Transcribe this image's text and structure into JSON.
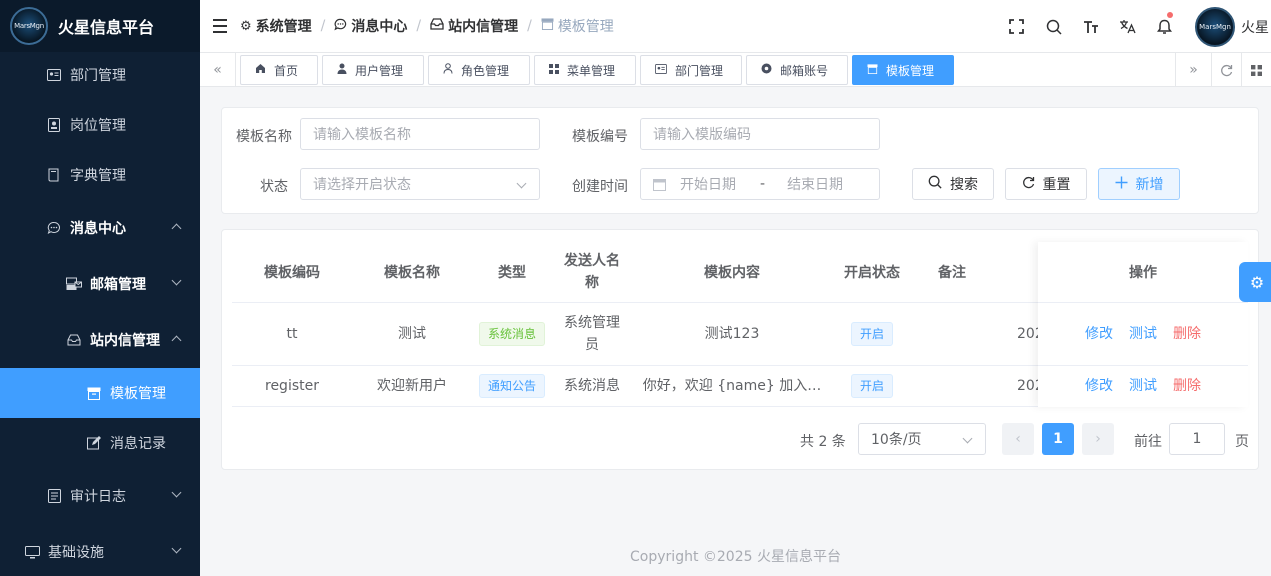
{
  "app": {
    "title": "火星信息平台",
    "logo_text": "MarsMgn"
  },
  "sidebar": {
    "items": [
      {
        "label": "部门管理",
        "icon": "id-card-icon"
      },
      {
        "label": "岗位管理",
        "icon": "badge-icon"
      },
      {
        "label": "字典管理",
        "icon": "book-icon"
      },
      {
        "label": "消息中心",
        "icon": "chat-icon"
      },
      {
        "label": "邮箱管理",
        "icon": "mail-server-icon"
      },
      {
        "label": "站内信管理",
        "icon": "inbox-icon"
      },
      {
        "label": "模板管理",
        "icon": "template-icon"
      },
      {
        "label": "消息记录",
        "icon": "edit-icon"
      },
      {
        "label": "审计日志",
        "icon": "log-icon"
      },
      {
        "label": "基础设施",
        "icon": "monitor-icon"
      }
    ]
  },
  "header": {
    "breadcrumb": [
      "系统管理",
      "消息中心",
      "站内信管理",
      "模板管理"
    ],
    "username": "火星"
  },
  "tags": [
    "首页",
    "用户管理",
    "角色管理",
    "菜单管理",
    "部门管理",
    "邮箱账号",
    "模板管理"
  ],
  "search": {
    "name_label": "模板名称",
    "name_placeholder": "请输入模板名称",
    "code_label": "模板编号",
    "code_placeholder": "请输入模版编码",
    "status_label": "状态",
    "status_placeholder": "请选择开启状态",
    "time_label": "创建时间",
    "start_placeholder": "开始日期",
    "range_sep": "-",
    "end_placeholder": "结束日期",
    "search_btn": "搜索",
    "reset_btn": "重置",
    "add_btn": "新增"
  },
  "table": {
    "headers": [
      "模板编码",
      "模板名称",
      "类型",
      "发送人名称",
      "模板内容",
      "开启状态",
      "备注",
      "操作"
    ],
    "rows": [
      {
        "code": "tt",
        "name": "测试",
        "type": "系统消息",
        "sender": "系统管理员",
        "content": "测试123",
        "status": "开启",
        "time": "202",
        "actions": [
          "修改",
          "测试",
          "删除"
        ]
      },
      {
        "code": "register",
        "name": "欢迎新用户",
        "type": "通知公告",
        "sender": "系统消息",
        "content": "你好，欢迎 {name} 加入…",
        "status": "开启",
        "time": "202",
        "actions": [
          "修改",
          "测试",
          "删除"
        ]
      }
    ]
  },
  "pagination": {
    "total": "共 2 条",
    "page_size": "10条/页",
    "current_page": "1",
    "goto_label": "前往",
    "goto_value": "1",
    "page_unit": "页"
  },
  "footer": "Copyright ©2025 火星信息平台",
  "colors": {
    "primary": "#409eff",
    "sidebar_bg": "#0f2034",
    "danger": "#f56c6c",
    "success": "#67c23a"
  }
}
